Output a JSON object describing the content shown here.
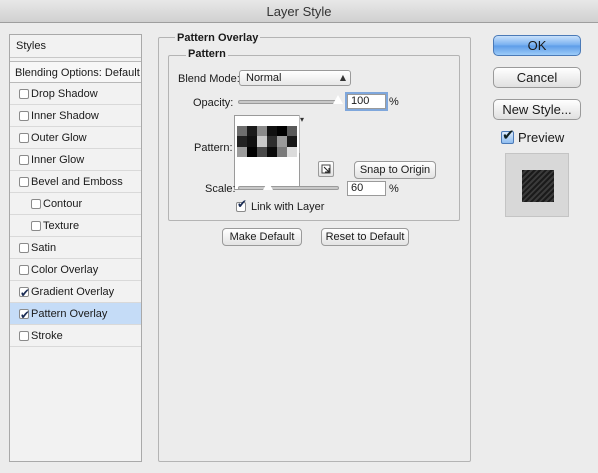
{
  "window": {
    "title": "Layer Style"
  },
  "sidebar": {
    "header": "Styles",
    "blending_options": "Blending Options: Default",
    "items": [
      {
        "label": "Drop Shadow",
        "checked": false
      },
      {
        "label": "Inner Shadow",
        "checked": false
      },
      {
        "label": "Outer Glow",
        "checked": false
      },
      {
        "label": "Inner Glow",
        "checked": false
      },
      {
        "label": "Bevel and Emboss",
        "checked": false
      },
      {
        "label": "Contour",
        "checked": false
      },
      {
        "label": "Texture",
        "checked": false
      },
      {
        "label": "Satin",
        "checked": false
      },
      {
        "label": "Color Overlay",
        "checked": false
      },
      {
        "label": "Gradient Overlay",
        "checked": true
      },
      {
        "label": "Pattern Overlay",
        "checked": true
      },
      {
        "label": "Stroke",
        "checked": false
      }
    ]
  },
  "panel": {
    "group_title": "Pattern Overlay",
    "subgroup_title": "Pattern",
    "blend_mode_label": "Blend Mode:",
    "blend_mode_value": "Normal",
    "opacity_label": "Opacity:",
    "opacity_value": "100",
    "opacity_unit": "%",
    "pattern_label": "Pattern:",
    "snap_button": "Snap to Origin",
    "scale_label": "Scale:",
    "scale_value": "60",
    "scale_unit": "%",
    "link_with_layer": "Link with Layer",
    "make_default": "Make Default",
    "reset_default": "Reset to Default"
  },
  "buttons": {
    "ok": "OK",
    "cancel": "Cancel",
    "new_style": "New Style..."
  },
  "preview": {
    "label": "Preview"
  },
  "colors": {
    "selected_row": "#c5dcf7",
    "default_button": "#5d9ce8"
  }
}
